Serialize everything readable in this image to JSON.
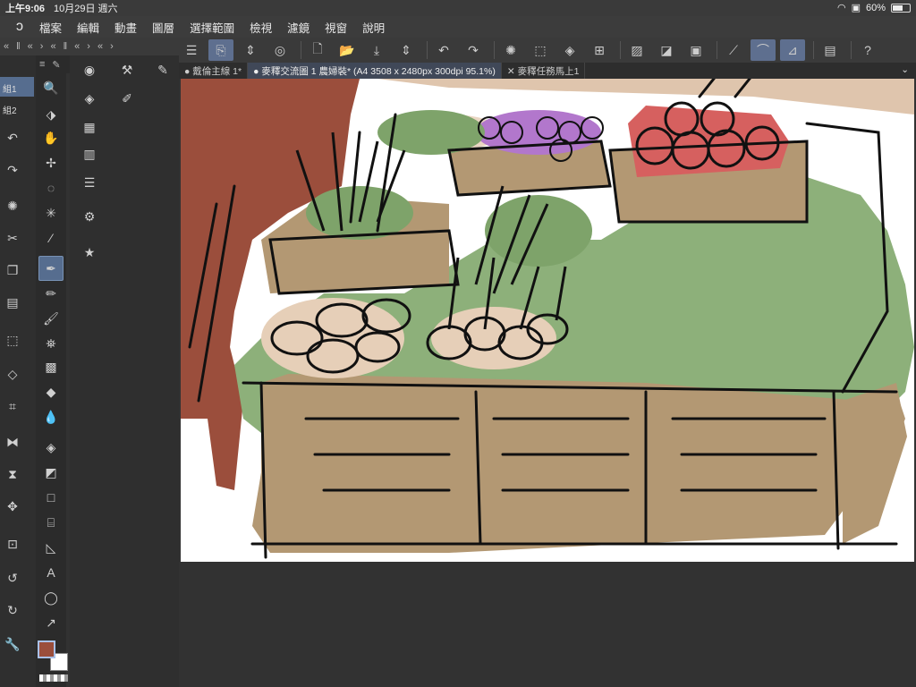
{
  "status": {
    "time": "上午9:06",
    "date": "10月29日 週六",
    "battery": "60%",
    "battery_level": 0.6
  },
  "menu": [
    "檔案",
    "編輯",
    "動畫",
    "圖層",
    "選擇範圍",
    "檢視",
    "濾鏡",
    "視窗",
    "說明"
  ],
  "layers": [
    "組1",
    "組2"
  ],
  "tabs": [
    {
      "label": "戴倫主線 1*"
    },
    {
      "label": "麥釋交流圖 1 農婦裝* (A4 3508 x 2480px 300dpi 95.1%)"
    },
    {
      "label": "麥釋任務馬上1"
    }
  ],
  "colors": {
    "foreground": "#9b4e3c",
    "background": "#ffffff",
    "accent": "#566d8f"
  }
}
